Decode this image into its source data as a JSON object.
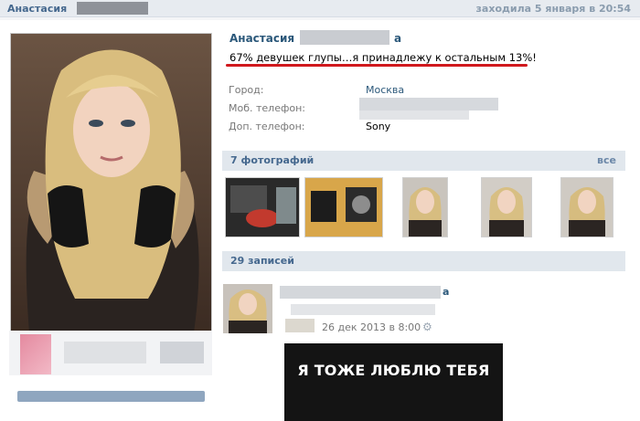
{
  "topbar": {
    "name": "Анастасия",
    "status": "заходила 5 января в 20:54"
  },
  "profile": {
    "name_first": "Анастасия",
    "name_tail": "а",
    "status": "67% девушек глупы…я принадлежу к остальным 13%!",
    "underline_color": "#d0181d",
    "info": [
      {
        "label": "Город:",
        "value": "Москва"
      },
      {
        "label": "Моб. телефон:",
        "value": ""
      },
      {
        "label": "Доп. телефон:",
        "value": "Sony"
      }
    ]
  },
  "photos": {
    "title": "7 фотографий",
    "more": "все"
  },
  "posts": {
    "title": "29 записей",
    "item": {
      "name_tail": "а",
      "date": "26 дек 2013 в 8:00",
      "meme_text": "Я ТОЖЕ ЛЮБЛЮ ТЕБЯ"
    }
  },
  "colors": {
    "link": "#2b587a",
    "header_bg": "#e1e7ed",
    "accent": "#45688e"
  },
  "icons": {
    "settings": "gear-icon"
  }
}
